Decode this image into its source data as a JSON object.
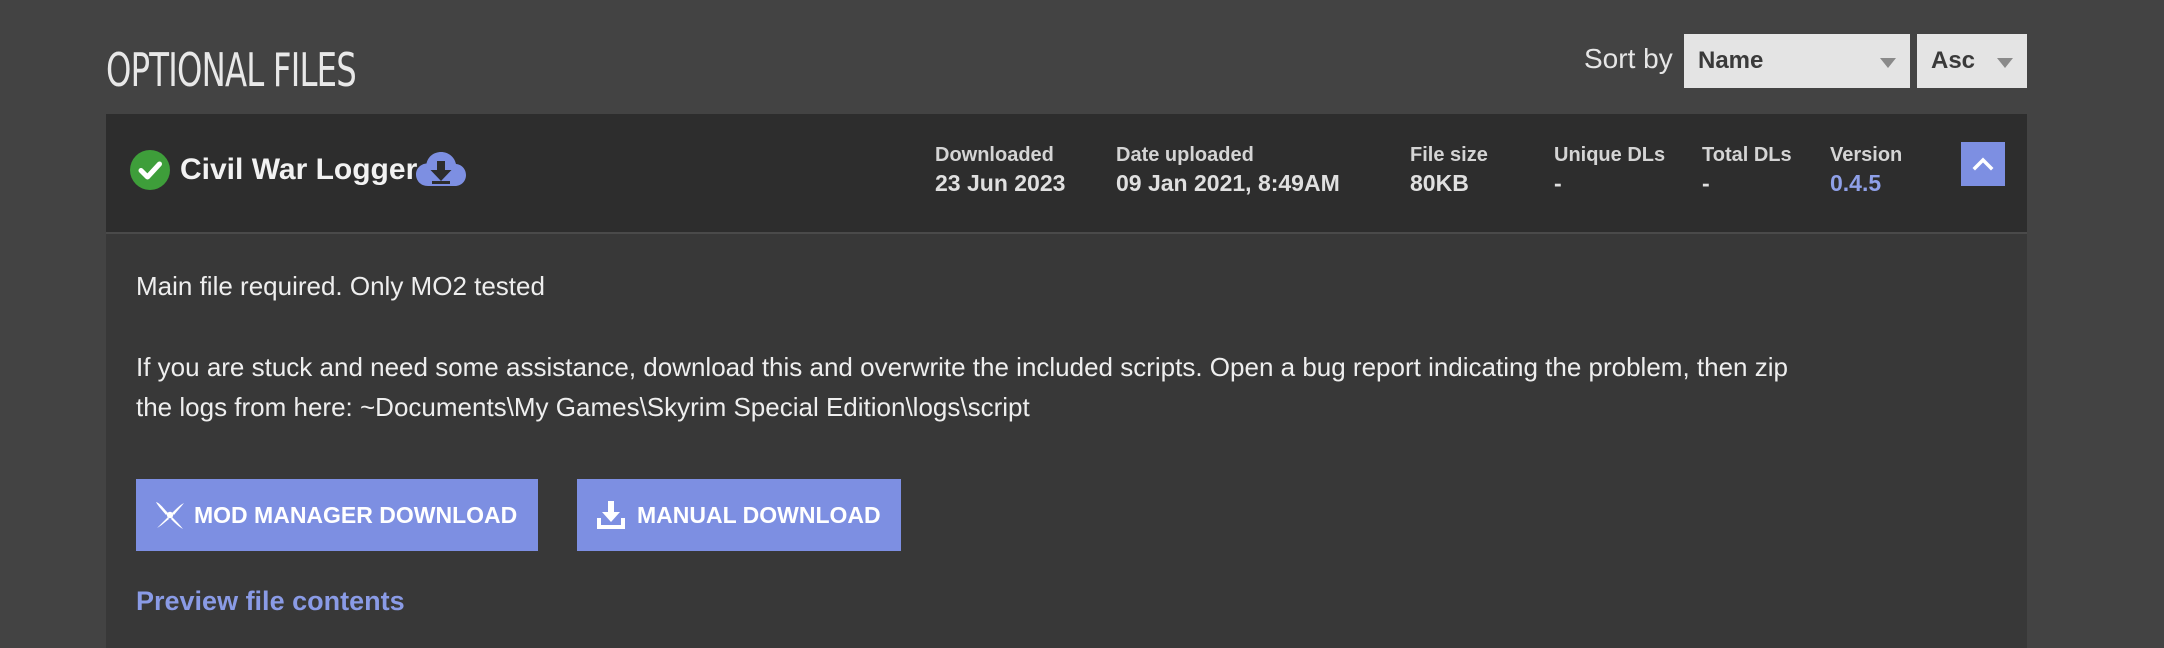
{
  "section": {
    "title": "OPTIONAL FILES"
  },
  "sort": {
    "label": "Sort by",
    "field_value": "Name",
    "order_value": "Asc"
  },
  "file": {
    "name": "Civil War Logger",
    "status_icon": "check-circle-icon",
    "download_icon": "cloud-download-icon",
    "stats": [
      {
        "label": "Downloaded",
        "value": "23 Jun 2023"
      },
      {
        "label": "Date uploaded",
        "value": "09 Jan 2021, 8:49AM"
      },
      {
        "label": "File size",
        "value": "80KB"
      },
      {
        "label": "Unique DLs",
        "value": "-"
      },
      {
        "label": "Total DLs",
        "value": "-"
      },
      {
        "label": "Version",
        "value": "0.4.5"
      }
    ],
    "description_line1": "Main file required. Only MO2 tested",
    "description_line2": "If you are stuck and need some assistance, download this and overwrite the included scripts. Open a bug report indicating the problem, then zip",
    "description_line3": "the logs from here: ~Documents\\My Games\\Skyrim Special Edition\\logs\\script",
    "mod_manager_label": "MOD MANAGER DOWNLOAD",
    "manual_label": "MANUAL DOWNLOAD",
    "preview_label": "Preview file contents"
  },
  "colors": {
    "accent": "#7d8fe2",
    "version": "#8fa0e8",
    "success": "#3e9e3a",
    "background": "#434343",
    "panel": "#383838",
    "header": "#2d2d2d"
  }
}
